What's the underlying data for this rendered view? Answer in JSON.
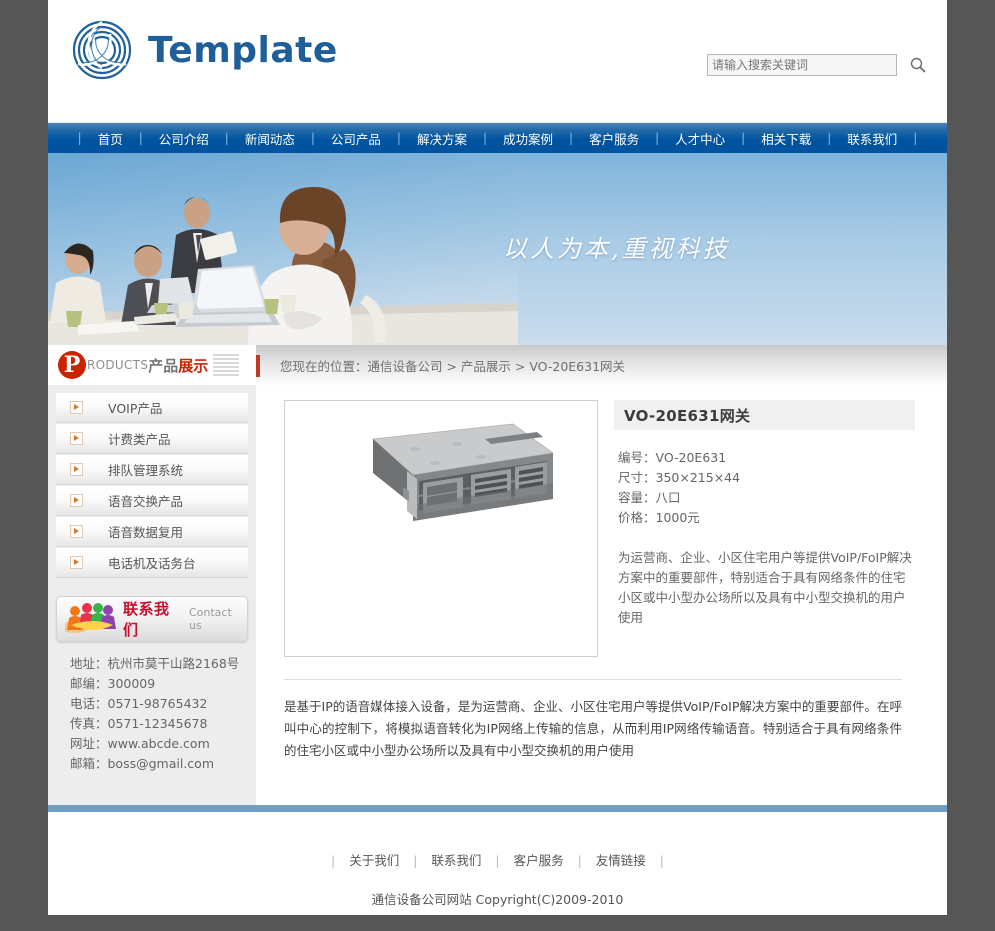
{
  "site": {
    "logo_text": "Template",
    "logo_icon": "spiral-trefoil-logo"
  },
  "search": {
    "placeholder": "请输入搜索关键词",
    "value": "",
    "button_icon": "search-icon"
  },
  "nav": {
    "items": [
      "首页",
      "公司介绍",
      "新闻动态",
      "公司产品",
      "解决方案",
      "成功案例",
      "客户服务",
      "人才中心",
      "相关下载",
      "联系我们"
    ]
  },
  "banner": {
    "slogan": "以人为本,重视科技",
    "photo_alt": "business-meeting-photo"
  },
  "sidebar": {
    "head": {
      "badge": "P",
      "english": "RODUCTS",
      "cn_gray": "产品",
      "cn_red": "展示"
    },
    "items": [
      "VOIP产品",
      "计费类产品",
      "排队管理系统",
      "语音交换产品",
      "语音数据复用",
      "电话机及话务台"
    ],
    "contact": {
      "title": "联系我们",
      "subtitle": "Contact us",
      "icon": "people-group-icon",
      "lines": [
        "地址：杭州市莫干山路2168号",
        "邮编：300009",
        "电话：0571-98765432",
        "传真：0571-12345678",
        "网址：www.abcde.com",
        "邮箱：boss@gmail.com"
      ]
    }
  },
  "main": {
    "breadcrumb": "您现在的位置：通信设备公司 > 产品展示 > VO-20E631网关",
    "product": {
      "image_alt": "rackmount-gateway-device-photo",
      "title": "VO-20E631网关",
      "specs": [
        "编号：VO-20E631",
        "尺寸：350×215×44",
        "容量：八口",
        "价格：1000元"
      ],
      "short_desc": "为运营商、企业、小区住宅用户等提供VoIP/FoIP解决方案中的重要部件，特别适合于具有网络条件的住宅小区或中小型办公场所以及具有中小型交换机的用户使用",
      "long_desc": "是基于IP的语音媒体接入设备，是为运营商、企业、小区住宅用户等提供VoIP/FoIP解决方案中的重要部件。在呼叫中心的控制下，将模拟语音转化为IP网络上传输的信息，从而利用IP网络传输语音。特别适合于具有网络条件的住宅小区或中小型办公场所以及具有中小型交换机的用户使用"
    }
  },
  "footer": {
    "links": [
      "关于我们",
      "联系我们",
      "客户服务",
      "友情链接"
    ],
    "copyright": "通信设备公司网站 Copyright(C)2009-2010"
  },
  "colors": {
    "nav_blue": "#00539f",
    "accent_red": "#cc2200",
    "page_bg": "#565656",
    "rule_blue": "#6f9fc4",
    "logo_blue": "#1e5f99"
  }
}
